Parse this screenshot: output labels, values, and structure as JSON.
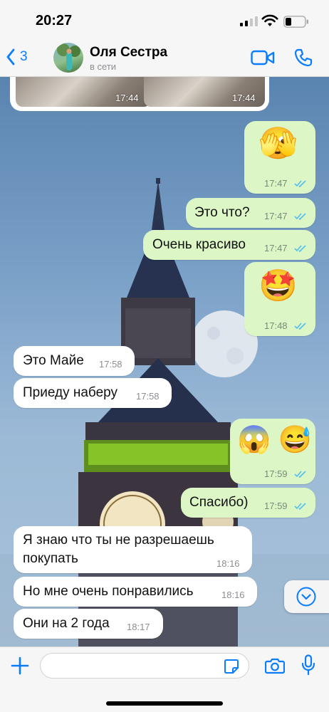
{
  "status_bar": {
    "time": "20:27"
  },
  "header": {
    "back_count": "3",
    "contact_name": "Оля Сестра",
    "contact_status": "в сети"
  },
  "media": {
    "time_left": "17:44",
    "time_right": "17:44"
  },
  "messages": [
    {
      "direction": "out",
      "emoji": "🫣",
      "time": "17:47",
      "read": true
    },
    {
      "direction": "out",
      "text": "Это что?",
      "time": "17:47",
      "read": true
    },
    {
      "direction": "out",
      "text": "Очень красиво",
      "time": "17:47",
      "read": true
    },
    {
      "direction": "out",
      "emoji": "🤩",
      "time": "17:48",
      "read": true
    },
    {
      "direction": "in",
      "text": "Это Майе",
      "time": "17:58"
    },
    {
      "direction": "in",
      "text": "Приеду наберу",
      "time": "17:58"
    },
    {
      "direction": "out",
      "emoji": "😱 😅",
      "time": "17:59",
      "read": true
    },
    {
      "direction": "out",
      "text": "Спасибо)",
      "time": "17:59",
      "read": true
    },
    {
      "direction": "in",
      "text_line1": "Я знаю что ты не разрешаешь",
      "text_line2": "покупать",
      "time": "18:16"
    },
    {
      "direction": "in",
      "text": "Но мне очень понравились",
      "time": "18:16"
    },
    {
      "direction": "in",
      "text": "Они на 2 года",
      "time": "18:17"
    }
  ],
  "composer": {
    "placeholder": "",
    "value": ""
  },
  "colors": {
    "accent": "#0a7cff",
    "outgoing_bubble": "#dcf7c5",
    "incoming_bubble": "#ffffff",
    "read_ticks": "#53bdeb"
  },
  "icons": {
    "back": "chevron-left-icon",
    "video": "video-camera-icon",
    "call": "phone-icon",
    "plus": "plus-icon",
    "sticker": "sticker-icon",
    "camera": "camera-icon",
    "mic": "microphone-icon",
    "scroll": "chevron-down-circle-icon"
  }
}
